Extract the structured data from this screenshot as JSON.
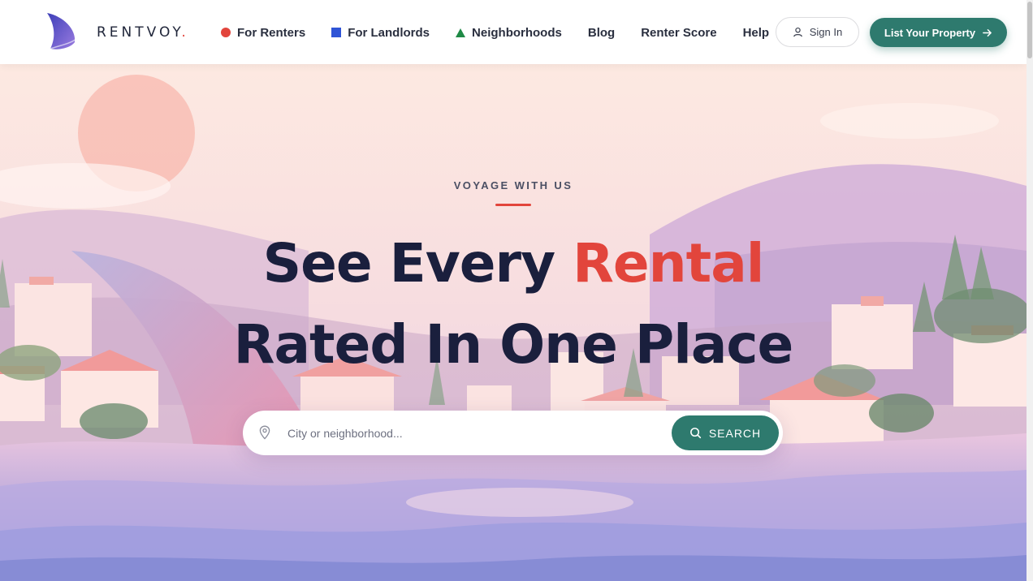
{
  "brand": {
    "name": "RENTVOY",
    "dot": "."
  },
  "nav": {
    "items": [
      {
        "label": "For Renters",
        "icon": "red-dot-icon"
      },
      {
        "label": "For Landlords",
        "icon": "blue-square-icon"
      },
      {
        "label": "Neighborhoods",
        "icon": "green-triangle-icon"
      },
      {
        "label": "Blog"
      },
      {
        "label": "Renter Score"
      },
      {
        "label": "Help"
      }
    ]
  },
  "header_actions": {
    "signin_label": "Sign In",
    "list_property_label": "List Your Property"
  },
  "hero": {
    "kicker": "VOYAGE WITH US",
    "title_part1": "See Every ",
    "title_accent": "Rental",
    "title_line2": "Rated In One Place"
  },
  "search": {
    "placeholder": "City or neighborhood...",
    "button_label": "SEARCH"
  },
  "colors": {
    "accent_red": "#e2453c",
    "brand_teal": "#2e7a6e",
    "heading_navy": "#1a1f3d",
    "landlords_blue": "#2f54d6",
    "neighborhoods_green": "#1f8a46"
  }
}
